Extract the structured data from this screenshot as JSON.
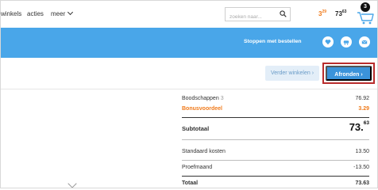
{
  "nav": {
    "winkels": "winkels",
    "acties": "acties",
    "meer": "meer"
  },
  "search": {
    "placeholder": "zoeken naar..."
  },
  "header": {
    "bonus_price_main": "3",
    "bonus_price_cents": "29",
    "total_price_main": "73",
    "total_price_cents": "63",
    "cart_count": "3"
  },
  "band": {
    "stop_label": "Stoppen met bestellen",
    "icons": [
      "heart-icon",
      "cart-swap-icon",
      "mail-icon"
    ]
  },
  "actions": {
    "verder_label": "Verder winkelen",
    "afronden_label": "Afronden"
  },
  "summary": {
    "boodschappen_label": "Boodschappen",
    "boodschappen_count": "3",
    "boodschappen_value": "76.92",
    "bonus_label": "Bonusvoordeel",
    "bonus_value": "3.29",
    "subtotaal_label": "Subtotaal",
    "subtotaal_main": "73.",
    "subtotaal_cents": "63",
    "standaard_label": "Standaard kosten",
    "standaard_value": "13.50",
    "proef_label": "Proefmaand",
    "proef_value": "-13.50",
    "totaal_label": "Totaal",
    "totaal_value": "73.63"
  },
  "colors": {
    "brand_blue": "#49a6e9",
    "button_blue": "#3b93da",
    "bonus_orange": "#f07a1a",
    "highlight_red": "#b92c2c"
  }
}
